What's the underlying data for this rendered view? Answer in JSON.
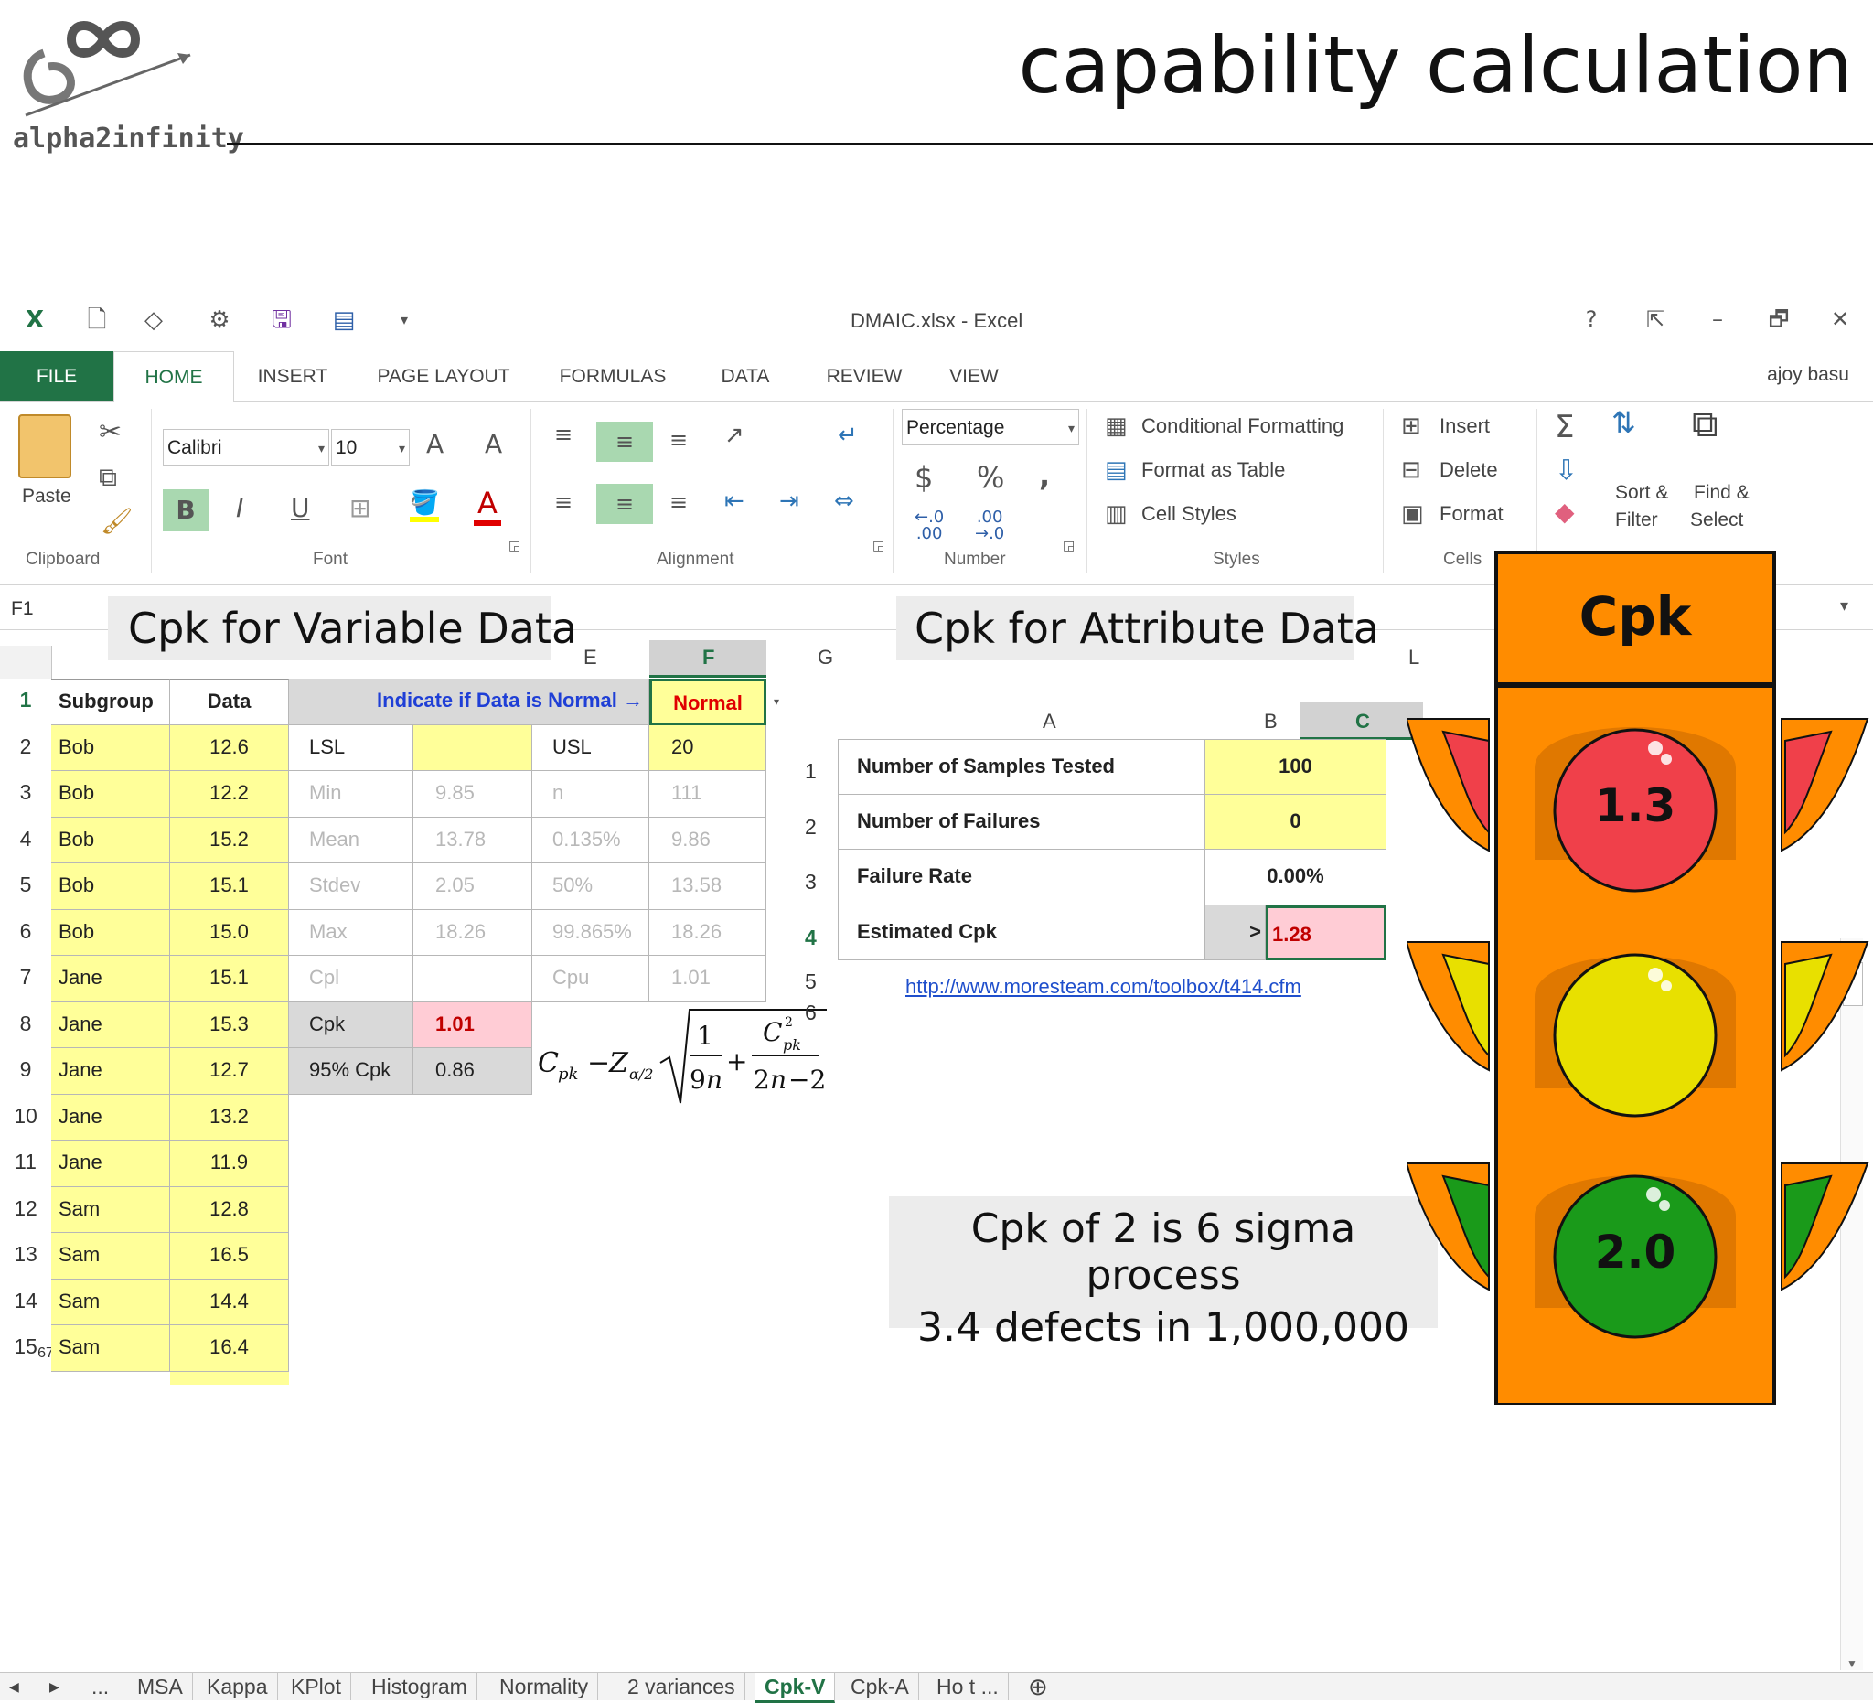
{
  "slide": {
    "title": "capability calculation",
    "logo_text": "alpha2infinity"
  },
  "window": {
    "title": "DMAIC.xlsx - Excel",
    "user": "ajoy basu",
    "help": "?",
    "minimize": "–",
    "restore": "🗗",
    "close": "✕"
  },
  "tabs": [
    "FILE",
    "HOME",
    "INSERT",
    "PAGE LAYOUT",
    "FORMULAS",
    "DATA",
    "REVIEW",
    "VIEW"
  ],
  "ribbon": {
    "paste": "Paste",
    "clipboard": "Clipboard",
    "font_name": "Calibri",
    "font_size": "10",
    "bold": "B",
    "italic": "I",
    "underline": "U",
    "font": "Font",
    "alignment": "Alignment",
    "number_format": "Percentage",
    "currency": "$",
    "percent": "%",
    "comma": ",",
    "inc_decimal": "←.0\n.00",
    "dec_decimal": ".00\n→.0",
    "number": "Number",
    "conditional_formatting": "Conditional Formatting",
    "format_as_table": "Format as Table",
    "cell_styles": "Cell Styles",
    "styles": "Styles",
    "insert": "Insert",
    "delete": "Delete",
    "format": "Format",
    "cells": "Cells",
    "sort_filter_1": "Sort &",
    "sort_filter_2": "Filter",
    "find_select_1": "Find &",
    "find_select_2": "Select"
  },
  "formula_bar": {
    "name_box": "F1"
  },
  "overlays": {
    "variable": "Cpk for Variable Data",
    "attribute": "Cpk for Attribute Data",
    "six_sigma_1": "Cpk of 2 is 6 sigma process",
    "six_sigma_2": "3.4 defects in 1,000,000"
  },
  "sheet": {
    "col_letters": {
      "e": "E",
      "f": "F",
      "g": "G",
      "l": "L"
    },
    "header": {
      "subgroup": "Subgroup",
      "data": "Data",
      "indicate": "Indicate if Data is Normal →",
      "normal": "Normal"
    },
    "rows": [
      {
        "n": "1"
      },
      {
        "n": "2",
        "name": "Bob",
        "value": "12.6"
      },
      {
        "n": "3",
        "name": "Bob",
        "value": "12.2"
      },
      {
        "n": "4",
        "name": "Bob",
        "value": "15.2"
      },
      {
        "n": "5",
        "name": "Bob",
        "value": "15.1"
      },
      {
        "n": "6",
        "name": "Bob",
        "value": "15.0"
      },
      {
        "n": "7",
        "name": "Jane",
        "value": "15.1"
      },
      {
        "n": "8",
        "name": "Jane",
        "value": "15.3"
      },
      {
        "n": "9",
        "name": "Jane",
        "value": "12.7"
      },
      {
        "n": "10",
        "name": "Jane",
        "value": "13.2"
      },
      {
        "n": "11",
        "name": "Jane",
        "value": "11.9"
      },
      {
        "n": "12",
        "name": "Sam",
        "value": "12.8"
      },
      {
        "n": "13",
        "name": "Sam",
        "value": "16.5"
      },
      {
        "n": "14",
        "name": "Sam",
        "value": "14.4"
      },
      {
        "n": "15",
        "name": "Sam",
        "value": "16.4"
      }
    ],
    "page_number": "67",
    "stats": [
      {
        "l1": "LSL",
        "v1": "",
        "l2": "USL",
        "v2": "20"
      },
      {
        "l1": "Min",
        "v1": "9.85",
        "l2": "n",
        "v2": "111"
      },
      {
        "l1": "Mean",
        "v1": "13.78",
        "l2": "0.135%",
        "v2": "9.86"
      },
      {
        "l1": "Stdev",
        "v1": "2.05",
        "l2": "50%",
        "v2": "13.58"
      },
      {
        "l1": "Max",
        "v1": "18.26",
        "l2": "99.865%",
        "v2": "18.26"
      },
      {
        "l1": "Cpl",
        "v1": "",
        "l2": "Cpu",
        "v2": "1.01"
      }
    ],
    "cpk": {
      "label": "Cpk",
      "value": "1.01"
    },
    "cpk95": {
      "label": "95% Cpk",
      "value": "0.86"
    }
  },
  "attribute": {
    "col_a": "A",
    "col_b": "B",
    "col_c": "C",
    "rows": [
      {
        "n": "1",
        "label": "Number of Samples Tested",
        "value": "100"
      },
      {
        "n": "2",
        "label": "Number of Failures",
        "value": "0"
      },
      {
        "n": "3",
        "label": "Failure Rate",
        "value": "0.00%"
      },
      {
        "n": "4",
        "label": "Estimated Cpk",
        "prefix": ">",
        "value": "1.28"
      }
    ],
    "row5": "5",
    "row6": "6",
    "link": "http://www.moresteam.com/toolbox/t414.cfm"
  },
  "traffic_light": {
    "title": "Cpk",
    "red": "1.3",
    "green": "2.0",
    "colors": {
      "body": "#ff8c00",
      "red": "#f0404a",
      "yellow": "#e8e000",
      "green": "#1a9a1a"
    }
  },
  "sheet_tabs": [
    "MSA",
    "Kappa",
    "KPlot",
    "Histogram",
    "Normality",
    "2 variances",
    "Cpk-V",
    "Cpk-A",
    "Ho t ..."
  ],
  "sheet_nav": {
    "prev": "◀",
    "next": "▶",
    "more": "...",
    "add": "⊕"
  }
}
